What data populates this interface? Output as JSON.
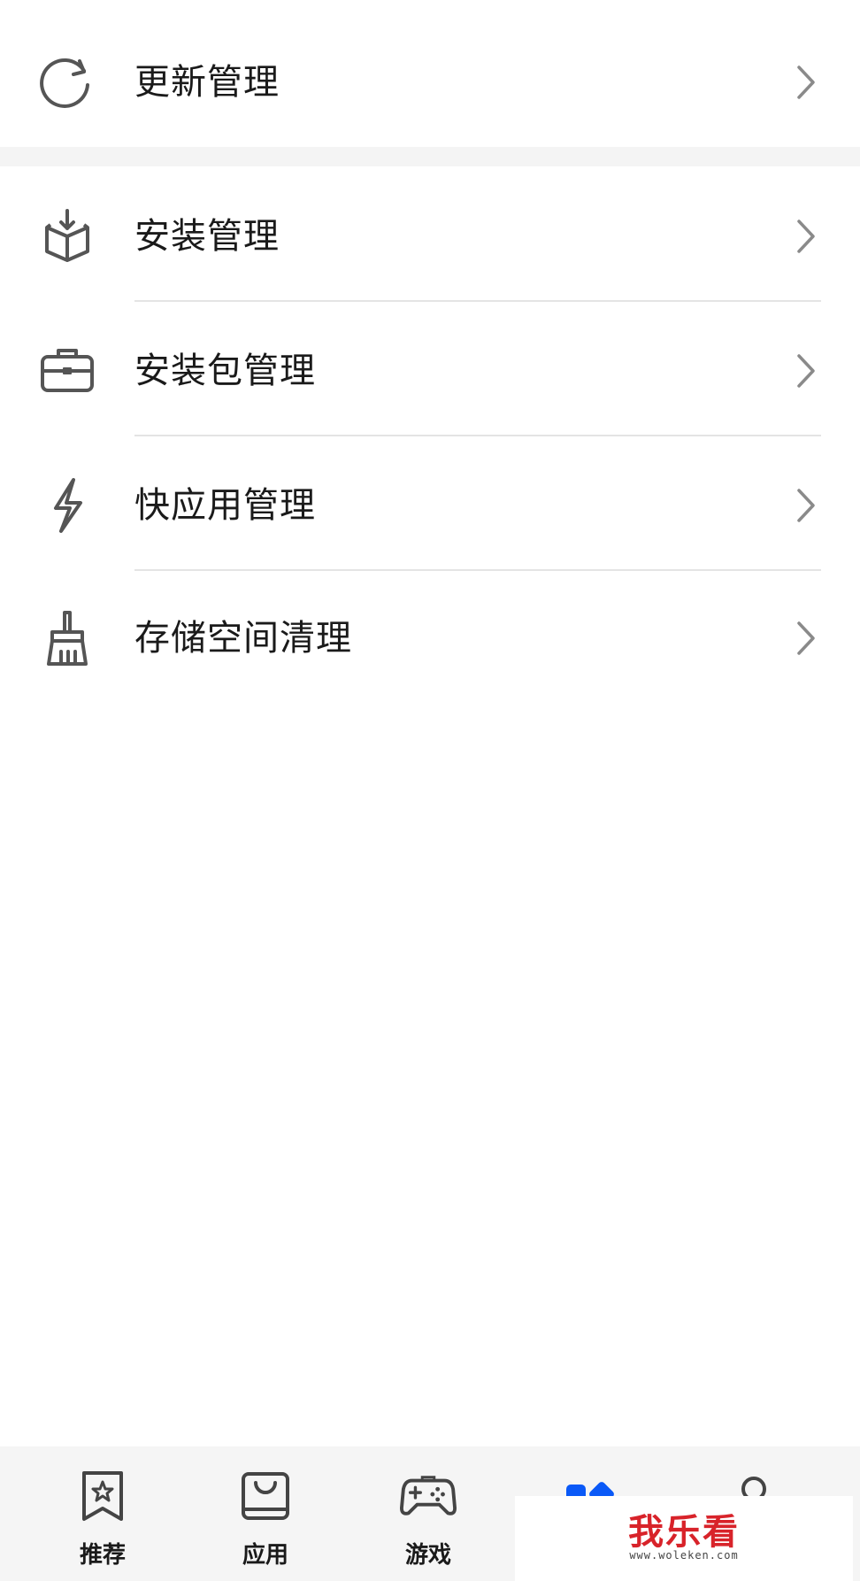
{
  "menu": {
    "items": [
      {
        "label": "更新管理",
        "icon": "refresh-icon"
      },
      {
        "label": "安装管理",
        "icon": "box-download-icon"
      },
      {
        "label": "安装包管理",
        "icon": "briefcase-icon"
      },
      {
        "label": "快应用管理",
        "icon": "lightning-icon"
      },
      {
        "label": "存储空间清理",
        "icon": "broom-icon"
      }
    ]
  },
  "bottom_nav": {
    "items": [
      {
        "label": "推荐",
        "icon": "bookmark-star-icon"
      },
      {
        "label": "应用",
        "icon": "shopping-bag-icon"
      },
      {
        "label": "游戏",
        "icon": "gamepad-icon"
      },
      {
        "label": "",
        "icon": "manage-icon"
      },
      {
        "label": "",
        "icon": "profile-icon"
      }
    ],
    "active_color": "#0a59f7"
  },
  "watermark": {
    "title": "我乐看",
    "url": "www.woleken.com"
  }
}
